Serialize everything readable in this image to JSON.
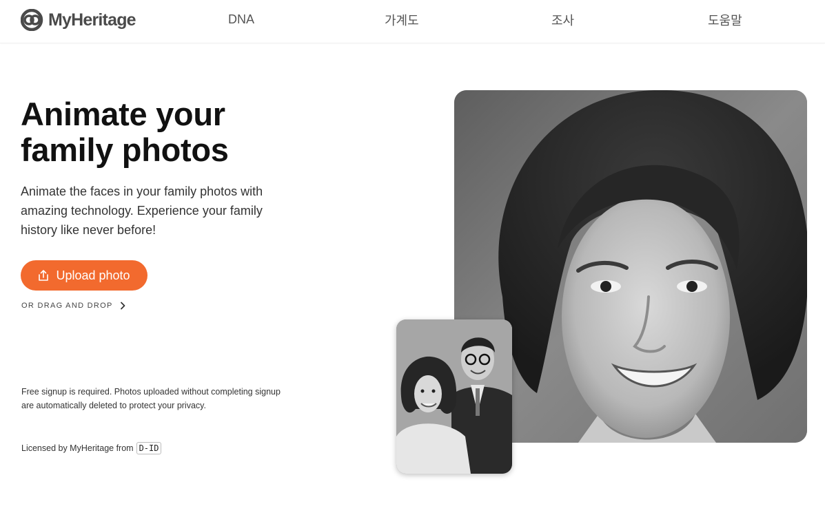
{
  "header": {
    "logo_text": "MyHeritage",
    "nav": {
      "dna": "DNA",
      "family_tree": "가계도",
      "research": "조사",
      "help": "도움말"
    }
  },
  "hero": {
    "title_line1": "Animate your",
    "title_line2": "family photos",
    "description": "Animate the faces in your family photos with amazing technology. Experience your family history like never before!",
    "upload_label": "Upload photo",
    "drag_drop_label": "OR DRAG AND DROP",
    "notice": "Free signup is required. Photos uploaded without completing signup are automatically deleted to protect your privacy.",
    "licensed_text": "Licensed by MyHeritage from",
    "partner_logo_text": "D-ID"
  },
  "icons": {
    "logo": "myheritage-logo-icon",
    "upload": "upload-icon",
    "chevron": "chevron-right-icon"
  },
  "colors": {
    "accent": "#f26a2e",
    "logo_gray": "#4a4a4a"
  }
}
